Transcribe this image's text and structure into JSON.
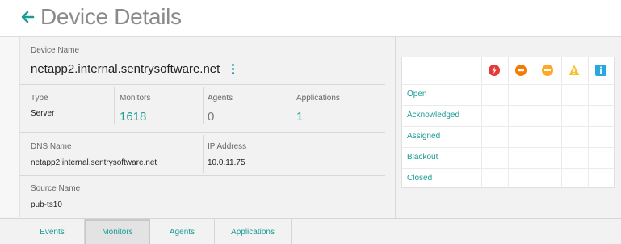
{
  "header": {
    "title": "Device Details",
    "back_icon": "left-arrow-icon"
  },
  "device": {
    "name_label": "Device Name",
    "name": "netapp2.internal.sentrysoftware.net",
    "type_label": "Type",
    "type": "Server",
    "monitors_label": "Monitors",
    "monitors": "1618",
    "agents_label": "Agents",
    "agents": "0",
    "applications_label": "Applications",
    "applications": "1",
    "dns_label": "DNS Name",
    "dns": "netapp2.internal.sentrysoftware.net",
    "ip_label": "IP Address",
    "ip": "10.0.11.75",
    "source_label": "Source Name",
    "source": "pub-ts10"
  },
  "alerts": {
    "rows": [
      "Open",
      "Acknowledged",
      "Assigned",
      "Blackout",
      "Closed"
    ],
    "severities": [
      {
        "name": "critical-icon",
        "color": "#e53935"
      },
      {
        "name": "major-icon",
        "color": "#f57c00"
      },
      {
        "name": "minor-icon",
        "color": "#ffa726"
      },
      {
        "name": "warning-icon",
        "color": "#fbc02d"
      },
      {
        "name": "info-icon",
        "color": "#29a8e0"
      }
    ]
  },
  "tabs": [
    "Events",
    "Monitors",
    "Agents",
    "Applications"
  ],
  "active_tab": "Monitors",
  "colors": {
    "accent": "#1a9b94",
    "title": "#8a8a8a"
  }
}
